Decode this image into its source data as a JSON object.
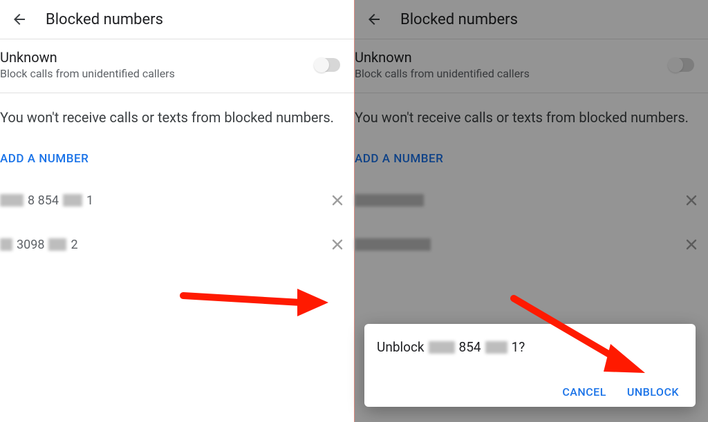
{
  "header": {
    "title": "Blocked numbers"
  },
  "unknown": {
    "title": "Unknown",
    "subtitle": "Block calls from unidentified callers"
  },
  "info": "You won't receive calls or texts from blocked numbers.",
  "addNumber": "ADD A NUMBER",
  "numbers": [
    {
      "middle": "8 854",
      "suffix": "1"
    },
    {
      "prefix": "3098",
      "suffix": "2"
    }
  ],
  "dialog": {
    "prefix": "Unblock",
    "middle": "854",
    "suffix": "1?",
    "cancel": "CANCEL",
    "unblock": "UNBLOCK"
  }
}
